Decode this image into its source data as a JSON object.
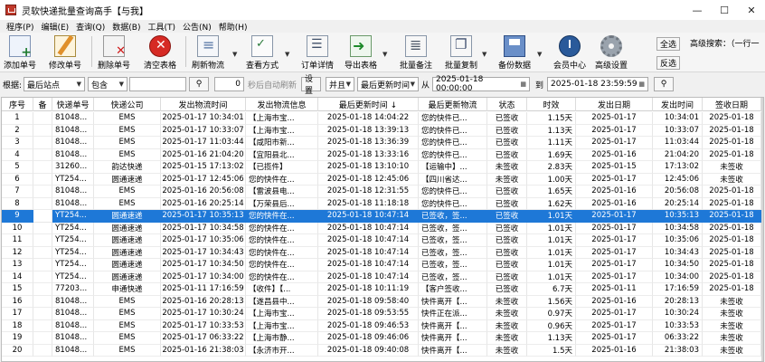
{
  "window": {
    "title": "灵软快递批量查询高手【与我】",
    "minimize_glyph": "—",
    "maximize_glyph": "☐",
    "close_glyph": "✕"
  },
  "menu": [
    "程序(P)",
    "编辑(E)",
    "查询(Q)",
    "数据(B)",
    "工具(T)",
    "公告(N)",
    "帮助(H)"
  ],
  "toolbar": {
    "buttons": [
      {
        "label": "添加单号",
        "icon": "add-document-icon"
      },
      {
        "label": "修改单号",
        "icon": "edit-pencil-icon"
      },
      {
        "label": "删除单号",
        "icon": "delete-document-icon"
      },
      {
        "label": "清空表格",
        "icon": "clear-red-x-icon"
      },
      {
        "label": "刷新物流",
        "icon": "refresh-list-icon"
      },
      {
        "label": "查看方式",
        "icon": "view-mode-icon"
      },
      {
        "label": "订单详情",
        "icon": "order-detail-icon"
      },
      {
        "label": "导出表格",
        "icon": "export-arrow-icon"
      },
      {
        "label": "批量备注",
        "icon": "batch-remark-icon"
      },
      {
        "label": "批量复制",
        "icon": "batch-copy-icon"
      },
      {
        "label": "备份数据",
        "icon": "floppy-disk-icon"
      },
      {
        "label": "会员中心",
        "icon": "member-clock-icon"
      },
      {
        "label": "高级设置",
        "icon": "settings-gear-icon"
      }
    ],
    "select_all": "全选",
    "invert_select": "反选",
    "advanced_search": "高级搜索：（一行一"
  },
  "filter": {
    "by_label": "根据:",
    "field": "最后站点",
    "match": "包含",
    "search_value": "",
    "refresh_seconds": "0",
    "auto_refresh_label": "秒后自动刷新",
    "settings_button": "设置",
    "logic": "并且",
    "time_field": "最后更新时间",
    "from_label": "从",
    "from_value": "2025-01-18 00:00:00",
    "to_label": "到",
    "to_value": "2025-01-18 23:59:59"
  },
  "table": {
    "columns": [
      "序号",
      "备",
      "快递单号",
      "快递公司",
      "发出物流时间",
      "发出物流信息",
      "最后更新时间 ↓",
      "最后更新物流",
      "状态",
      "时效",
      "发出日期",
      "发出时间",
      "签收日期",
      "签收"
    ],
    "selected_row": 8,
    "rows": [
      [
        "1",
        "",
        "81048...",
        "EMS",
        "2025-01-17 10:34:01",
        "【上海市宝...",
        "2025-01-18 14:04:22",
        "您的快件已...",
        "已签收",
        "1.15天",
        "2025-01-17",
        "10:34:01",
        "2025-01-18",
        "14:0"
      ],
      [
        "2",
        "",
        "81048...",
        "EMS",
        "2025-01-17 10:33:07",
        "【上海市宝...",
        "2025-01-18 13:39:13",
        "您的快件已...",
        "已签收",
        "1.13天",
        "2025-01-17",
        "10:33:07",
        "2025-01-18",
        "13:3"
      ],
      [
        "3",
        "",
        "81048...",
        "EMS",
        "2025-01-17 11:03:44",
        "【咸阳市新...",
        "2025-01-18 13:36:39",
        "您的快件已...",
        "已签收",
        "1.11天",
        "2025-01-17",
        "11:03:44",
        "2025-01-18",
        "13:3"
      ],
      [
        "4",
        "",
        "81048...",
        "EMS",
        "2025-01-16 21:04:20",
        "【宜阳县北...",
        "2025-01-18 13:33:16",
        "您的快件已...",
        "已签收",
        "1.69天",
        "2025-01-16",
        "21:04:20",
        "2025-01-18",
        "13:3"
      ],
      [
        "5",
        "",
        "31260...",
        "韵达快递",
        "2025-01-15 17:13:02",
        "【已揽件】",
        "2025-01-18 13:10:10",
        "【运输中】...",
        "未签收",
        "2.83天",
        "2025-01-15",
        "17:13:02",
        "未签收",
        ""
      ],
      [
        "6",
        "",
        "YT254...",
        "圆通速递",
        "2025-01-17 12:45:06",
        "您的快件在...",
        "2025-01-18 12:45:06",
        "【四川省达...",
        "未签收",
        "1.00天",
        "2025-01-17",
        "12:45:06",
        "未签收",
        ""
      ],
      [
        "7",
        "",
        "81048...",
        "EMS",
        "2025-01-16 20:56:08",
        "【雷波县电...",
        "2025-01-18 12:31:55",
        "您的快件已...",
        "已签收",
        "1.65天",
        "2025-01-16",
        "20:56:08",
        "2025-01-18",
        "12:3"
      ],
      [
        "8",
        "",
        "81048...",
        "EMS",
        "2025-01-16 20:25:14",
        "【万荣县后...",
        "2025-01-18 11:18:18",
        "您的快件已...",
        "已签收",
        "1.62天",
        "2025-01-16",
        "20:25:14",
        "2025-01-18",
        "11:1"
      ],
      [
        "9",
        "",
        "YT254...",
        "圆通速递",
        "2025-01-17 10:35:13",
        "您的快件在...",
        "2025-01-18 10:47:14",
        "已签收，签...",
        "已签收",
        "1.01天",
        "2025-01-17",
        "10:35:13",
        "2025-01-18",
        "10:4"
      ],
      [
        "10",
        "",
        "YT254...",
        "圆通速递",
        "2025-01-17 10:34:58",
        "您的快件在...",
        "2025-01-18 10:47:14",
        "已签收，签...",
        "已签收",
        "1.01天",
        "2025-01-17",
        "10:34:58",
        "2025-01-18",
        "10:4"
      ],
      [
        "11",
        "",
        "YT254...",
        "圆通速递",
        "2025-01-17 10:35:06",
        "您的快件在...",
        "2025-01-18 10:47:14",
        "已签收，签...",
        "已签收",
        "1.01天",
        "2025-01-17",
        "10:35:06",
        "2025-01-18",
        "10:4"
      ],
      [
        "12",
        "",
        "YT254...",
        "圆通速递",
        "2025-01-17 10:34:43",
        "您的快件在...",
        "2025-01-18 10:47:14",
        "已签收，签...",
        "已签收",
        "1.01天",
        "2025-01-17",
        "10:34:43",
        "2025-01-18",
        "10:4"
      ],
      [
        "13",
        "",
        "YT254...",
        "圆通速递",
        "2025-01-17 10:34:50",
        "您的快件在...",
        "2025-01-18 10:47:14",
        "已签收，签...",
        "已签收",
        "1.01天",
        "2025-01-17",
        "10:34:50",
        "2025-01-18",
        "10:4"
      ],
      [
        "14",
        "",
        "YT254...",
        "圆通速递",
        "2025-01-17 10:34:00",
        "您的快件在...",
        "2025-01-18 10:47:14",
        "已签收，签...",
        "已签收",
        "1.01天",
        "2025-01-17",
        "10:34:00",
        "2025-01-18",
        "10:4"
      ],
      [
        "15",
        "",
        "77203...",
        "申通快递",
        "2025-01-11 17:16:59",
        "【收件】【...",
        "2025-01-18 10:11:19",
        "【客户签收...",
        "已签收",
        "6.7天",
        "2025-01-11",
        "17:16:59",
        "2025-01-18",
        "10:1"
      ],
      [
        "16",
        "",
        "81048...",
        "EMS",
        "2025-01-16 20:28:13",
        "【遂昌县中...",
        "2025-01-18 09:58:40",
        "快件离开【...",
        "未签收",
        "1.56天",
        "2025-01-16",
        "20:28:13",
        "未签收",
        ""
      ],
      [
        "17",
        "",
        "81048...",
        "EMS",
        "2025-01-17 10:30:24",
        "【上海市宝...",
        "2025-01-18 09:53:55",
        "快件正在派...",
        "未签收",
        "0.97天",
        "2025-01-17",
        "10:30:24",
        "未签收",
        ""
      ],
      [
        "18",
        "",
        "81048...",
        "EMS",
        "2025-01-17 10:33:53",
        "【上海市宝...",
        "2025-01-18 09:46:53",
        "快件离开【...",
        "未签收",
        "0.96天",
        "2025-01-17",
        "10:33:53",
        "未签收",
        ""
      ],
      [
        "19",
        "",
        "81048...",
        "EMS",
        "2025-01-17 06:33:22",
        "【上海市静...",
        "2025-01-18 09:46:06",
        "快件离开【...",
        "未签收",
        "1.13天",
        "2025-01-17",
        "06:33:22",
        "未签收",
        ""
      ],
      [
        "20",
        "",
        "81048...",
        "EMS",
        "2025-01-16 21:38:03",
        "【永济市开...",
        "2025-01-18 09:40:08",
        "快件离开【...",
        "未签收",
        "1.5天",
        "2025-01-16",
        "21:38:03",
        "未签收",
        ""
      ]
    ]
  }
}
